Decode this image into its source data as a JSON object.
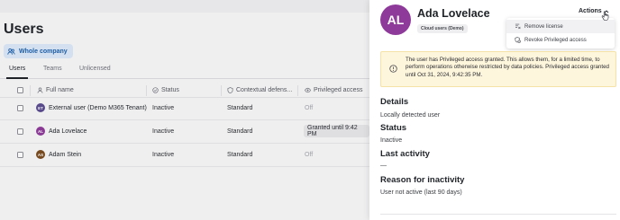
{
  "page": {
    "title": "Users"
  },
  "scope": {
    "label": "Whole company",
    "icon": "people-icon"
  },
  "tabs": [
    {
      "label": "Users",
      "active": true
    },
    {
      "label": "Teams",
      "active": false
    },
    {
      "label": "Unlicensed",
      "active": false
    }
  ],
  "table": {
    "columns": [
      {
        "label": "Full name",
        "icon": "person-icon"
      },
      {
        "label": "Status",
        "icon": "check-circle-icon"
      },
      {
        "label": "Contextual defens...",
        "icon": "shield-icon"
      },
      {
        "label": "Privileged access",
        "icon": "eye-icon"
      }
    ],
    "rows": [
      {
        "initials": "ET",
        "avatar_color": "#5b4c8f",
        "name": "External user (Demo M365 Tenant)",
        "status": "Inactive",
        "defense": "Standard",
        "privileged": "Off",
        "privileged_pill": false
      },
      {
        "initials": "AL",
        "avatar_color": "#8e3a9a",
        "name": "Ada Lovelace",
        "status": "Inactive",
        "defense": "Standard",
        "privileged": "Granted until 9:42 PM",
        "privileged_pill": true
      },
      {
        "initials": "AS",
        "avatar_color": "#7a4a1e",
        "name": "Adam Stein",
        "status": "Inactive",
        "defense": "Standard",
        "privileged": "Off",
        "privileged_pill": false
      }
    ]
  },
  "panel": {
    "initials": "AL",
    "avatar_color": "#8e3a9a",
    "name": "Ada Lovelace",
    "group": "Cloud users (Demo)",
    "actions_label": "Actions",
    "menu": [
      {
        "label": "Remove license",
        "icon": "remove-license-icon"
      },
      {
        "label": "Revoke Privileged access",
        "icon": "shield-revoke-icon"
      }
    ],
    "alert": {
      "icon": "info-icon",
      "text": "The user has Privileged access granted. This allows them, for a limited time, to perform operations otherwise restricted by data policies. Privileged access granted until Oct 31, 2024, 9:42:35 PM."
    },
    "details": {
      "heading": "Details",
      "value": "Locally detected user"
    },
    "status": {
      "heading": "Status",
      "value": "Inactive"
    },
    "last_activity": {
      "heading": "Last activity",
      "value": "—"
    },
    "reason": {
      "heading": "Reason for inactivity",
      "value": "User not active (last 90 days)"
    }
  }
}
